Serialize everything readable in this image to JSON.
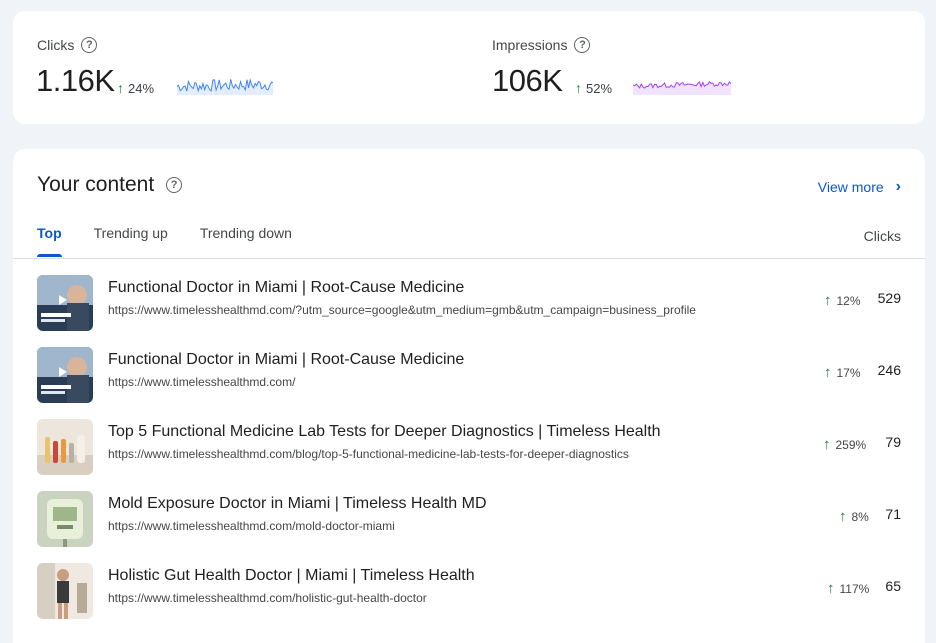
{
  "metrics": {
    "clicks": {
      "label": "Clicks",
      "value": "1.16K",
      "change": "24%",
      "spark_color": "#4285f4"
    },
    "impressions": {
      "label": "Impressions",
      "value": "106K",
      "change": "52%",
      "spark_color": "#a142f4"
    }
  },
  "content": {
    "title": "Your content",
    "view_more": "View more",
    "tabs": [
      "Top",
      "Trending up",
      "Trending down"
    ],
    "active_tab": "Top",
    "column_header": "Clicks",
    "rows": [
      {
        "title": "Functional Doctor in Miami | Root-Cause Medicine",
        "url": "https://www.timelesshealthmd.com/?utm_source=google&utm_medium=gmb&utm_campaign=business_profile",
        "change": "12%",
        "clicks": "529",
        "thumb": "video-thumbnail"
      },
      {
        "title": "Functional Doctor in Miami | Root-Cause Medicine",
        "url": "https://www.timelesshealthmd.com/",
        "change": "17%",
        "clicks": "246",
        "thumb": "video-thumbnail"
      },
      {
        "title": "Top 5 Functional Medicine Lab Tests for Deeper Diagnostics | Timeless Health",
        "url": "https://www.timelesshealthmd.com/blog/top-5-functional-medicine-lab-tests-for-deeper-diagnostics",
        "change": "259%",
        "clicks": "79",
        "thumb": "lab-tubes-thumbnail"
      },
      {
        "title": "Mold Exposure Doctor in Miami | Timeless Health MD",
        "url": "https://www.timelesshealthmd.com/mold-doctor-miami",
        "change": "8%",
        "clicks": "71",
        "thumb": "iv-bag-thumbnail"
      },
      {
        "title": "Holistic Gut Health Doctor | Miami | Timeless Health",
        "url": "https://www.timelesshealthmd.com/holistic-gut-health-doctor",
        "change": "117%",
        "clicks": "65",
        "thumb": "person-photo-thumbnail"
      }
    ]
  }
}
